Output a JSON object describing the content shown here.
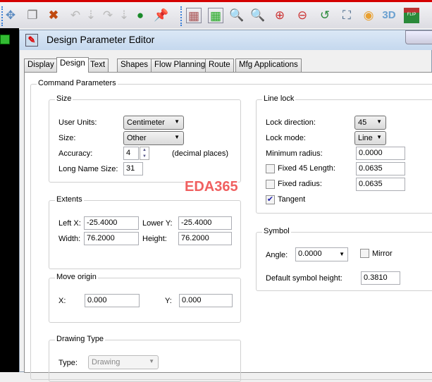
{
  "toolbar": {
    "icons": [
      "move-icon",
      "copy-icon",
      "delete-icon",
      "undo-icon",
      "undo-down-icon",
      "redo-icon",
      "redo-down-icon",
      "green-ball-icon",
      "pin-icon",
      "grid-icon",
      "design-grid-icon",
      "zoom-window-icon",
      "zoom-board-icon",
      "zoom-in-icon",
      "zoom-out-icon",
      "zoom-previous-icon",
      "zoom-extents-icon",
      "refresh-icon",
      "3d-view-icon",
      "flip-view-icon"
    ],
    "flip_label": "FLIP",
    "label_3d": "3D"
  },
  "dialog": {
    "title": "Design Parameter Editor"
  },
  "tabs": [
    "Display",
    "Design",
    "Text",
    "Shapes",
    "Flow Planning",
    "Route",
    "Mfg Applications"
  ],
  "active_tab": "Design",
  "command_parameters": "Command Parameters",
  "size": {
    "title": "Size",
    "user_units_label": "User Units:",
    "user_units": "Centimeter",
    "size_label": "Size:",
    "size": "Other",
    "accuracy_label": "Accuracy:",
    "accuracy": "4",
    "decimal_places": "(decimal places)",
    "long_name_label": "Long Name Size:",
    "long_name": "31"
  },
  "extents": {
    "title": "Extents",
    "left_x_label": "Left X:",
    "left_x": "-25.4000",
    "lower_y_label": "Lower Y:",
    "lower_y": "-25.4000",
    "width_label": "Width:",
    "width": "76.2000",
    "height_label": "Height:",
    "height": "76.2000"
  },
  "move_origin": {
    "title": "Move origin",
    "x_label": "X:",
    "x": "0.000",
    "y_label": "Y:",
    "y": "0.000"
  },
  "drawing_type": {
    "title": "Drawing Type",
    "type_label": "Type:",
    "type": "Drawing"
  },
  "line_lock": {
    "title": "Line lock",
    "lock_direction_label": "Lock direction:",
    "lock_direction": "45",
    "lock_mode_label": "Lock mode:",
    "lock_mode": "Line",
    "min_radius_label": "Minimum radius:",
    "min_radius": "0.0000",
    "fixed45_label": "Fixed 45 Length:",
    "fixed45": "0.0635",
    "fixed45_checked": false,
    "fixed_radius_label": "Fixed radius:",
    "fixed_radius": "0.0635",
    "fixed_radius_checked": false,
    "tangent_label": "Tangent",
    "tangent_checked": true
  },
  "symbol": {
    "title": "Symbol",
    "angle_label": "Angle:",
    "angle": "0.0000",
    "mirror_label": "Mirror",
    "mirror_checked": false,
    "default_height_label": "Default symbol height:",
    "default_height": "0.3810"
  },
  "watermark": "EDA365"
}
